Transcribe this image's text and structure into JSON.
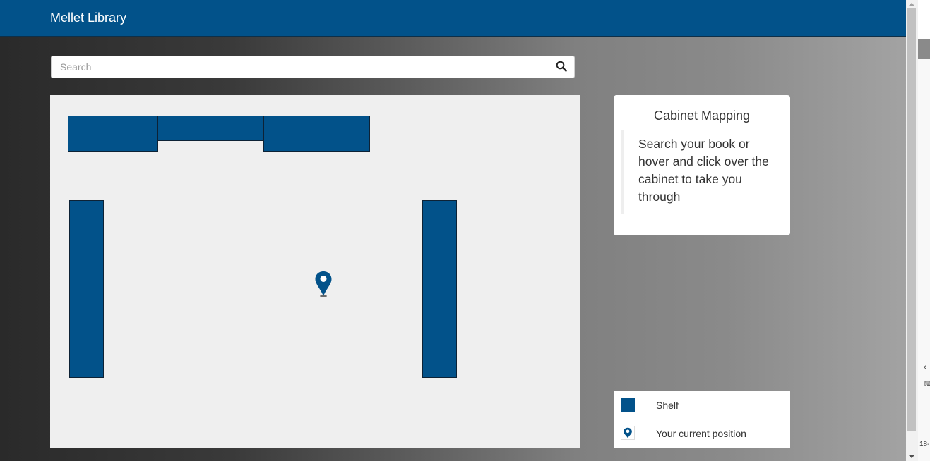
{
  "app": {
    "title": "Mellet Library"
  },
  "search": {
    "placeholder": "Search",
    "value": ""
  },
  "map": {
    "shelf_color": "#02528a",
    "background": "#efefef",
    "shelves": [
      "shelf-top-left",
      "shelf-top-middle",
      "shelf-top-right",
      "shelf-left-column",
      "shelf-right-column"
    ]
  },
  "info": {
    "title": "Cabinet Mapping",
    "description": "Search your book or hover and click over the cabinet to take you through"
  },
  "legend": {
    "items": [
      {
        "icon": "shelf-swatch-icon",
        "label": "Shelf"
      },
      {
        "icon": "location-pin-icon",
        "label": "Your current position"
      }
    ]
  },
  "side_strip": {
    "text": "18-"
  },
  "colors": {
    "navbar": "#02528a",
    "accent": "#02528a"
  }
}
